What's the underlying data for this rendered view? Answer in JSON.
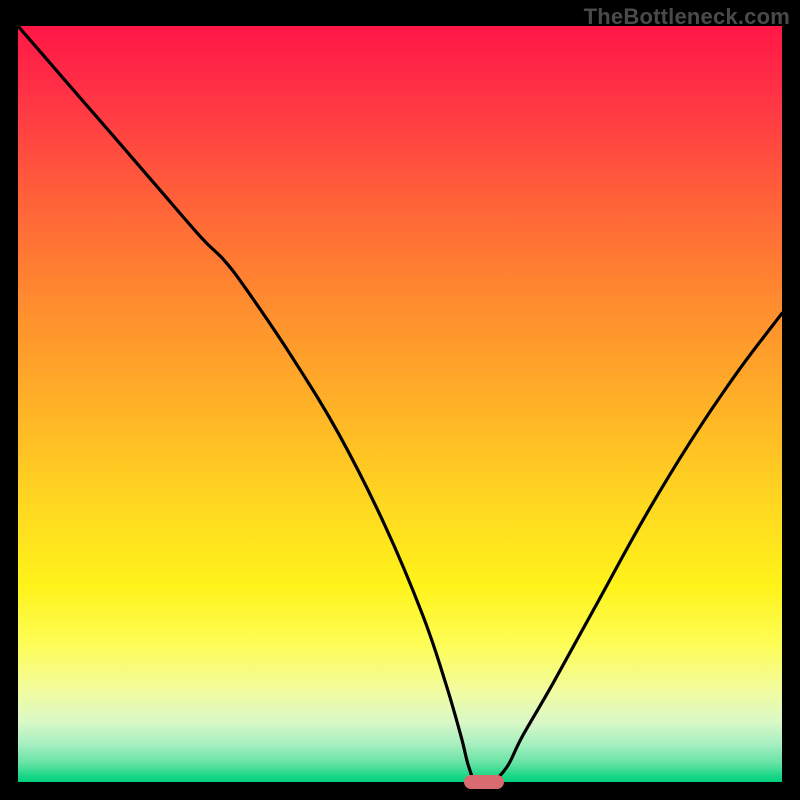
{
  "watermark": "TheBottleneck.com",
  "colors": {
    "frame": "#000000",
    "watermark_text": "#4a4a4a",
    "curve_stroke": "#000000",
    "marker": "#d86b6f",
    "gradient_top": "#ff1746",
    "gradient_bottom": "#00d07f"
  },
  "chart_data": {
    "type": "line",
    "title": "",
    "xlabel": "",
    "ylabel": "",
    "xlim": [
      0,
      100
    ],
    "ylim": [
      0,
      100
    ],
    "legend": false,
    "grid": false,
    "series": [
      {
        "name": "bottleneck-curve",
        "x": [
          0,
          6,
          12,
          18,
          24,
          27,
          30,
          36,
          42,
          48,
          53,
          56,
          58,
          59,
          60,
          62,
          64,
          66,
          70,
          76,
          82,
          88,
          94,
          100
        ],
        "values": [
          100,
          93,
          86,
          79,
          72,
          69,
          65,
          56,
          46,
          34,
          22,
          13,
          6,
          2,
          0,
          0,
          2,
          6,
          13,
          24,
          35,
          45,
          54,
          62
        ]
      }
    ],
    "annotations": [
      {
        "name": "bottleneck-marker",
        "shape": "pill",
        "x": 61,
        "y": 0,
        "width_pct": 5.2,
        "color": "#d86b6f"
      }
    ],
    "background": "vertical-gradient-rainbow"
  }
}
